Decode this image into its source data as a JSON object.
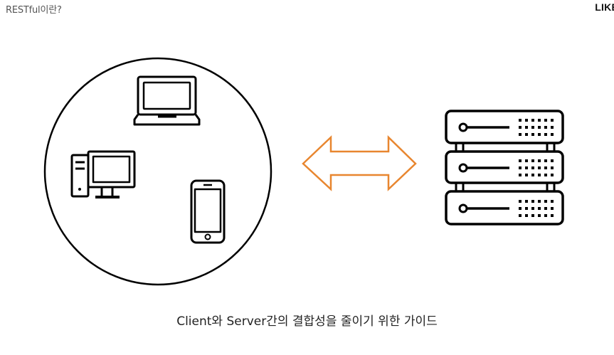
{
  "header": {
    "title": "RESTful이란?",
    "brand": "LIKE"
  },
  "diagram": {
    "client_group": [
      "laptop-icon",
      "desktop-pc-icon",
      "smartphone-icon"
    ],
    "connector": "double-arrow-icon",
    "server": "server-rack-icon",
    "arrow_color": "#E8862F",
    "stroke_color": "#000000"
  },
  "caption": "Client와 Server간의 결합성을 줄이기 위한 가이드"
}
